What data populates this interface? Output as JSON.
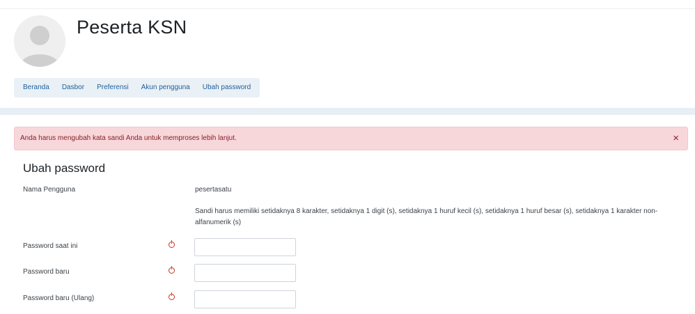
{
  "header": {
    "title": "Peserta KSN"
  },
  "nav": {
    "items": [
      "Beranda",
      "Dasbor",
      "Preferensi",
      "Akun pengguna",
      "Ubah password"
    ]
  },
  "alert": {
    "message": "Anda harus mengubah kata sandi Anda untuk memproses lebih lanjut.",
    "close_label": "×"
  },
  "form": {
    "title": "Ubah password",
    "username_label": "Nama Pengguna",
    "username_value": "pesertasatu",
    "hint": "Sandi harus memiliki setidaknya 8 karakter, setidaknya 1 digit (s), setidaknya 1 huruf kecil (s), setidaknya 1 huruf besar (s), setidaknya 1 karakter non-alfanumerik (s)",
    "fields": [
      {
        "label": "Password saat ini",
        "value": ""
      },
      {
        "label": "Password baru",
        "value": ""
      },
      {
        "label": "Password baru (Ulang)",
        "value": ""
      }
    ]
  },
  "colors": {
    "alert_bg": "#f8d7da",
    "alert_text": "#842029",
    "link": "#1f5f9a",
    "required": "#ca3120"
  }
}
